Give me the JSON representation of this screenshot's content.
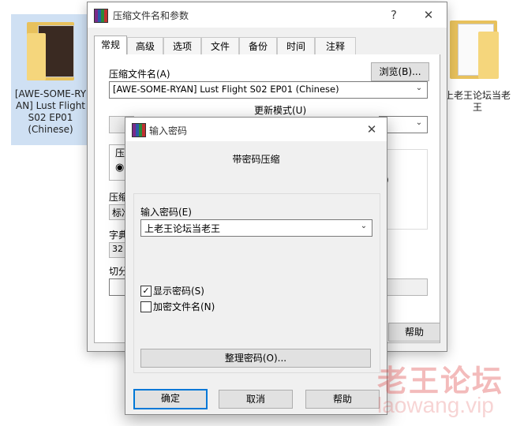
{
  "desktop": {
    "left_icon_label": "[AWE-SOME-RYAN] Lust Flight S02 EP01 (Chinese)",
    "left_icon_lines": [
      "[AWE-SOME-RY",
      "AN] Lust Flight",
      "S02 EP01",
      "(Chinese)"
    ],
    "right_icon_lines": [
      "上老王论坛当老",
      "王"
    ]
  },
  "main_window": {
    "title": "压缩文件名和参数",
    "help_glyph": "?",
    "close_glyph": "✕",
    "tabs": [
      "常规",
      "高级",
      "选项",
      "文件",
      "备份",
      "时间",
      "注释"
    ],
    "archive_name_label": "压缩文件名(A)",
    "browse_button": "浏览(B)...",
    "archive_name_value": "[AWE-SOME-RYAN] Lust Flight S02 EP01 (Chinese)",
    "update_mode_label": "更新模式(U)",
    "partial_labels": [
      "压",
      "压缩",
      "标准",
      "字典",
      "32 M",
      "切分"
    ],
    "partial_right": ")",
    "help_button": "帮助"
  },
  "password_dialog": {
    "title": "输入密码",
    "close_glyph": "✕",
    "heading": "带密码压缩",
    "password_label": "输入密码(E)",
    "password_value": "上老王论坛当老王",
    "show_password_label": "显示密码(S)",
    "show_password_checked": "✓",
    "encrypt_names_label": "加密文件名(N)",
    "organize_button": "整理密码(O)...",
    "ok_button": "确定",
    "cancel_button": "取消",
    "help_button": "帮助"
  },
  "watermark": {
    "text": "老王论坛",
    "url": "laowang.vip"
  },
  "colors": {
    "accent": "#0078d7",
    "window_bg": "#f0f0f0",
    "selection_bg": "#cfe0f3"
  }
}
